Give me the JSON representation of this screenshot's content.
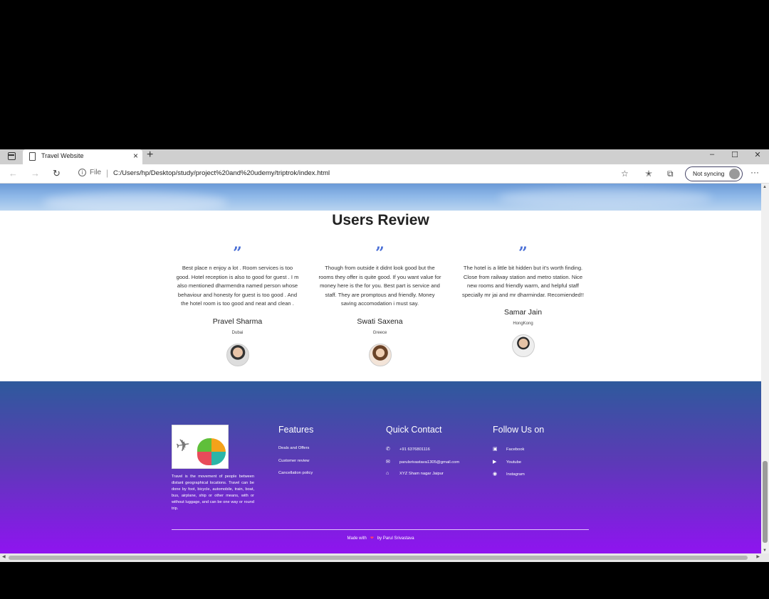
{
  "browser": {
    "tab_title": "Travel Website",
    "tab_close": "×",
    "new_tab": "+",
    "url_prefix": "File",
    "url": "C:/Users/hp/Desktop/study/project%20and%20udemy/triptrok/index.html",
    "sync_label": "Not syncing",
    "more_menu": "···",
    "window": {
      "minimize": "–",
      "maximize": "☐",
      "close": "✕"
    }
  },
  "reviews": {
    "title": "Users Review",
    "quote_glyph": "”",
    "items": [
      {
        "text": "Best place n enjoy a lot . Room services is too good. Hotel reception is also to good for guest . I m also mentioned dharmendra named person whose behaviour and honesty for guest is too good . And the hotel room is too good and neat and clean .",
        "name": "Pravel Sharma",
        "place": "Dubai"
      },
      {
        "text": "Though from outside it didnt look good but the rooms they offer is quite good. If you want value for money here is the for you. Best part is service and staff. They are promptous and friendly. Money saving accomodation i must say.",
        "name": "Swati Saxena",
        "place": "Greece"
      },
      {
        "text": "The hotel is a little bit hidden but it's worth finding. Close from railway station and metro station. Nice new rooms and friendly warm, and helpful staff specially mr jai and mr dharmindar. Recomiended!!",
        "name": "Samar Jain",
        "place": "HongKong"
      }
    ]
  },
  "footer": {
    "about": "Travel is the movement of people between distant geographical locations. Travel can be done by foot, bicycle, automobile, train, boat, bus, airplane, ship or other means, with or without luggage, and can be one way or round trip.",
    "features": {
      "title": "Features",
      "items": [
        "Deals and Offers",
        "Customer review",
        "Cancellation policy"
      ]
    },
    "contact": {
      "title": "Quick Contact",
      "items": [
        {
          "icon": "phone-icon",
          "text": "+91 6376801116"
        },
        {
          "icon": "mail-icon",
          "text": "parulsrivastava1305@gmail.com"
        },
        {
          "icon": "home-icon",
          "text": "XYZ Sham nagar Jaipur"
        }
      ]
    },
    "follow": {
      "title": "Follow Us on",
      "items": [
        {
          "icon": "facebook-icon",
          "text": "Facebook"
        },
        {
          "icon": "youtube-icon",
          "text": "Youtube"
        },
        {
          "icon": "instagram-icon",
          "text": "Instagram"
        }
      ]
    },
    "made_with_prefix": "Made with",
    "made_with_suffix": "by Parul Srivastava"
  },
  "colors": {
    "footer_top": "#2e5a9c",
    "footer_bottom": "#8f14f0",
    "quote_accent": "#4a6fd6",
    "heart": "#ff3d6e"
  }
}
